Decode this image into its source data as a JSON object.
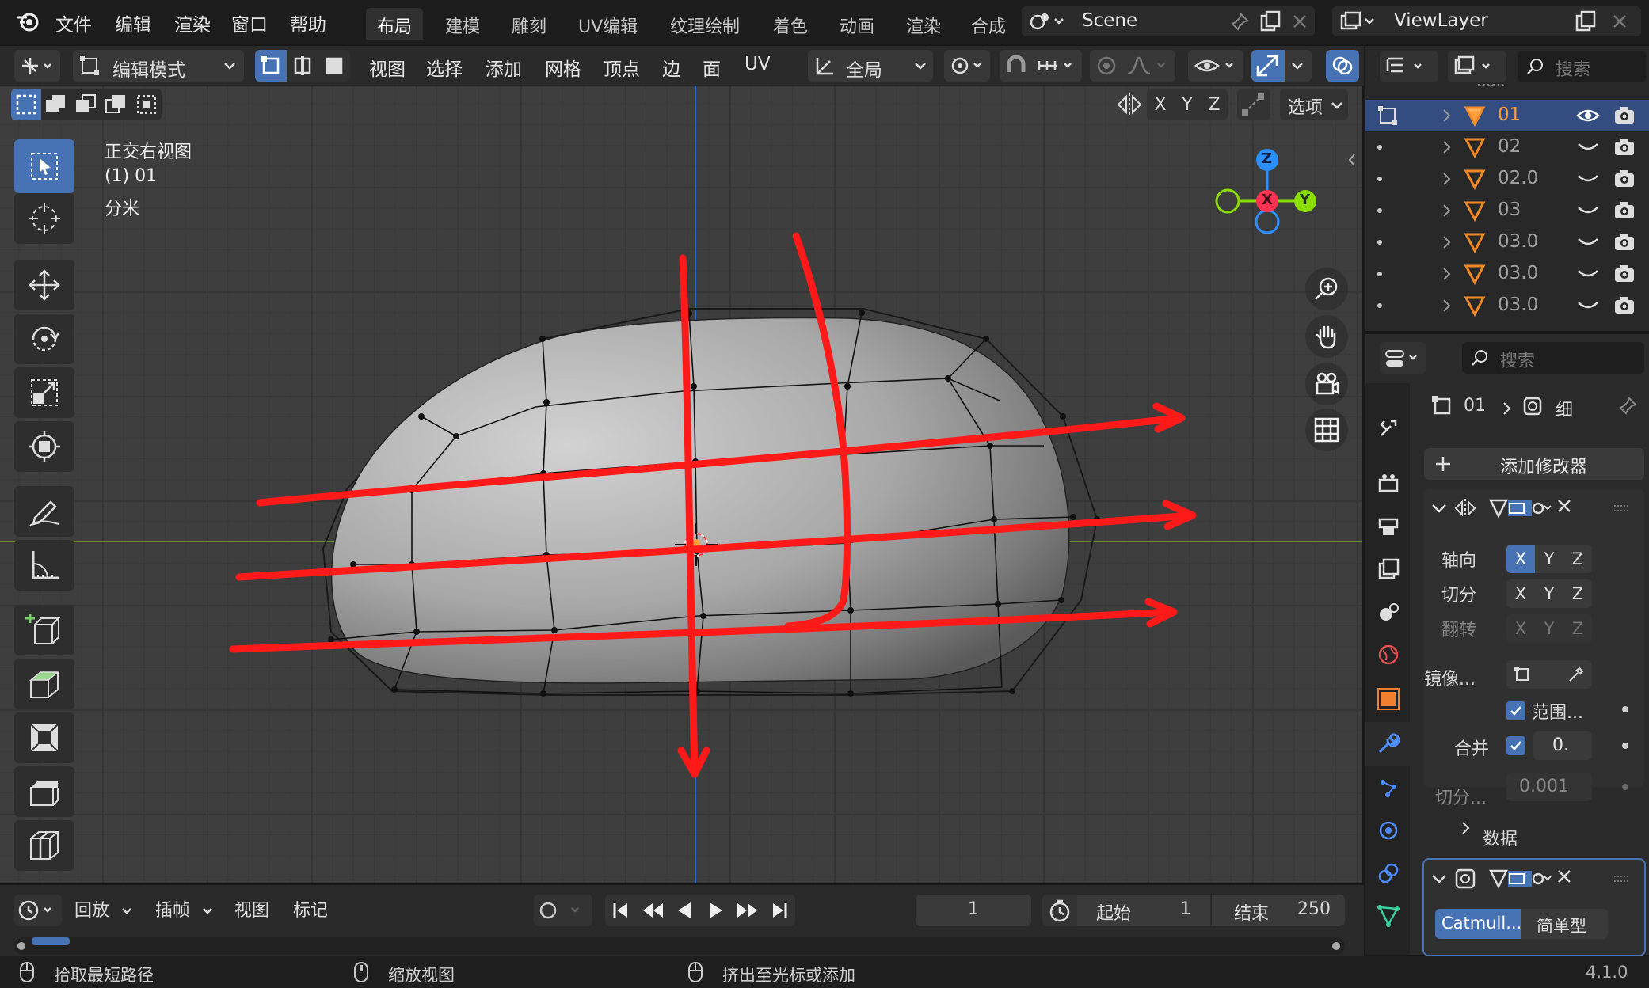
{
  "menu": {
    "file": "文件",
    "edit": "编辑",
    "render": "渲染",
    "window": "窗口",
    "help": "帮助"
  },
  "workspaces": [
    "布局",
    "建模",
    "雕刻",
    "UV编辑",
    "纹理绘制",
    "着色",
    "动画",
    "渲染",
    "合成"
  ],
  "scene_name": "Scene",
  "view_layer": "ViewLayer",
  "header": {
    "mode": "编辑模式",
    "view": "视图",
    "select": "选择",
    "add": "添加",
    "mesh": "网格",
    "vertex": "顶点",
    "edge": "边",
    "face": "面",
    "uv": "UV",
    "transform_orientation": "全局",
    "options": "选项"
  },
  "axis_labels": {
    "x": "X",
    "y": "Y",
    "z": "Z"
  },
  "viewport": {
    "view_name": "正交右视图",
    "object_line": "(1) 01",
    "unit": "分米"
  },
  "outliner": {
    "search_placeholder": "搜索",
    "clipped_top": "bak",
    "items": [
      "01",
      "02",
      "02.0",
      "03",
      "03.0",
      "03.0",
      "03.0"
    ]
  },
  "properties": {
    "search_placeholder": "搜索",
    "breadcrumb_object": "01",
    "breadcrumb_modifier": "细",
    "add_modifier": "添加修改器",
    "axis": "轴向",
    "bisect": "切分",
    "flip": "翻转",
    "mirror_object": "镜像...",
    "clipping": "范围...",
    "merge": "合并",
    "merge_value": "0.",
    "bisect_distance": "切分...",
    "bisect_distance_value": "0.001",
    "data": "数据",
    "subdiv_catmull": "Catmull...",
    "subdiv_simple": "简单型"
  },
  "timeline": {
    "playback": "回放",
    "keying": "插帧",
    "view": "视图",
    "marker": "标记",
    "current_frame": "1",
    "start_label": "起始",
    "start": "1",
    "end_label": "结束",
    "end": "250"
  },
  "status": {
    "left": "拾取最短路径",
    "middle": "缩放视图",
    "right": "挤出至光标或添加",
    "version": "4.1.0"
  },
  "colors": {
    "accent": "#4772b3",
    "selected_object": "#ff9e3d",
    "annotation": "#ff1a1a",
    "gizmo_x": "#ff3352",
    "gizmo_y": "#8bdc00",
    "gizmo_z": "#2c8fff"
  }
}
